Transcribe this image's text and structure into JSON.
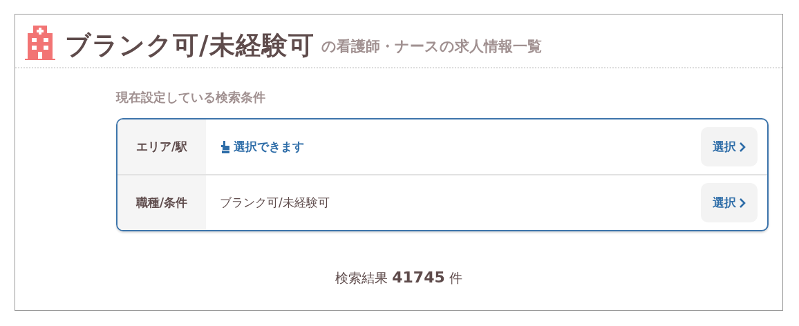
{
  "heading": {
    "title": "ブランク可/未経験可",
    "subtitle": "の看護師・ナースの求人情報一覧"
  },
  "conditions": {
    "caption": "現在設定している検索条件",
    "rows": [
      {
        "label": "エリア/駅",
        "kind": "prompt",
        "value": "選択できます",
        "button": "選択"
      },
      {
        "label": "職種/条件",
        "kind": "value",
        "value": "ブランク可/未経験可",
        "button": "選択"
      }
    ]
  },
  "result": "検索結果 **41745** 件"
}
